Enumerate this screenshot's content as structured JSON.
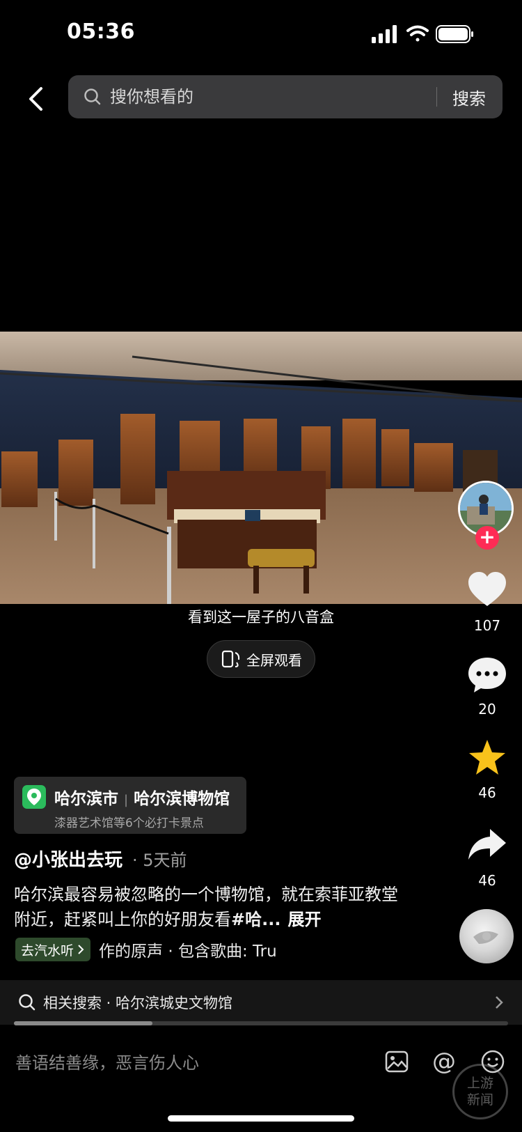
{
  "status_bar": {
    "time": "05:36",
    "battery_icon": "battery-icon",
    "wifi_icon": "wifi-icon",
    "signal_icon": "signal-icon"
  },
  "header": {
    "search_placeholder": "搜你想看的",
    "search_button": "搜索"
  },
  "video": {
    "subtitle": "看到这一屋子的八音盒",
    "fullscreen_label": "全屏观看"
  },
  "actions": {
    "likes": "107",
    "comments": "20",
    "favorites": "46",
    "shares": "46"
  },
  "location": {
    "city": "哈尔滨市",
    "place": "哈尔滨博物馆",
    "subtitle": "漆器艺术馆等6个必打卡景点"
  },
  "post": {
    "author": "@小张出去玩",
    "time": "· 5天前",
    "caption": "哈尔滨最容易被忽略的一个博物馆，就在索菲亚教堂附近，赶紧叫上你的好朋友看",
    "hashtag": "#哈...",
    "expand": "展开"
  },
  "music": {
    "tag": "去汽水听",
    "text": "作的原声 · 包含歌曲: Tru"
  },
  "related": {
    "text": "相关搜索 · 哈尔滨城史文物馆"
  },
  "progress": {
    "fraction": 0.28
  },
  "comment_bar": {
    "placeholder": "善语结善缘，恶言伤人心"
  },
  "watermark": {
    "line1": "上游",
    "line2": "新闻"
  },
  "colors": {
    "accent": "#fe2c55",
    "favorite": "#f8c21b",
    "location_pin": "#2bbb5c"
  }
}
